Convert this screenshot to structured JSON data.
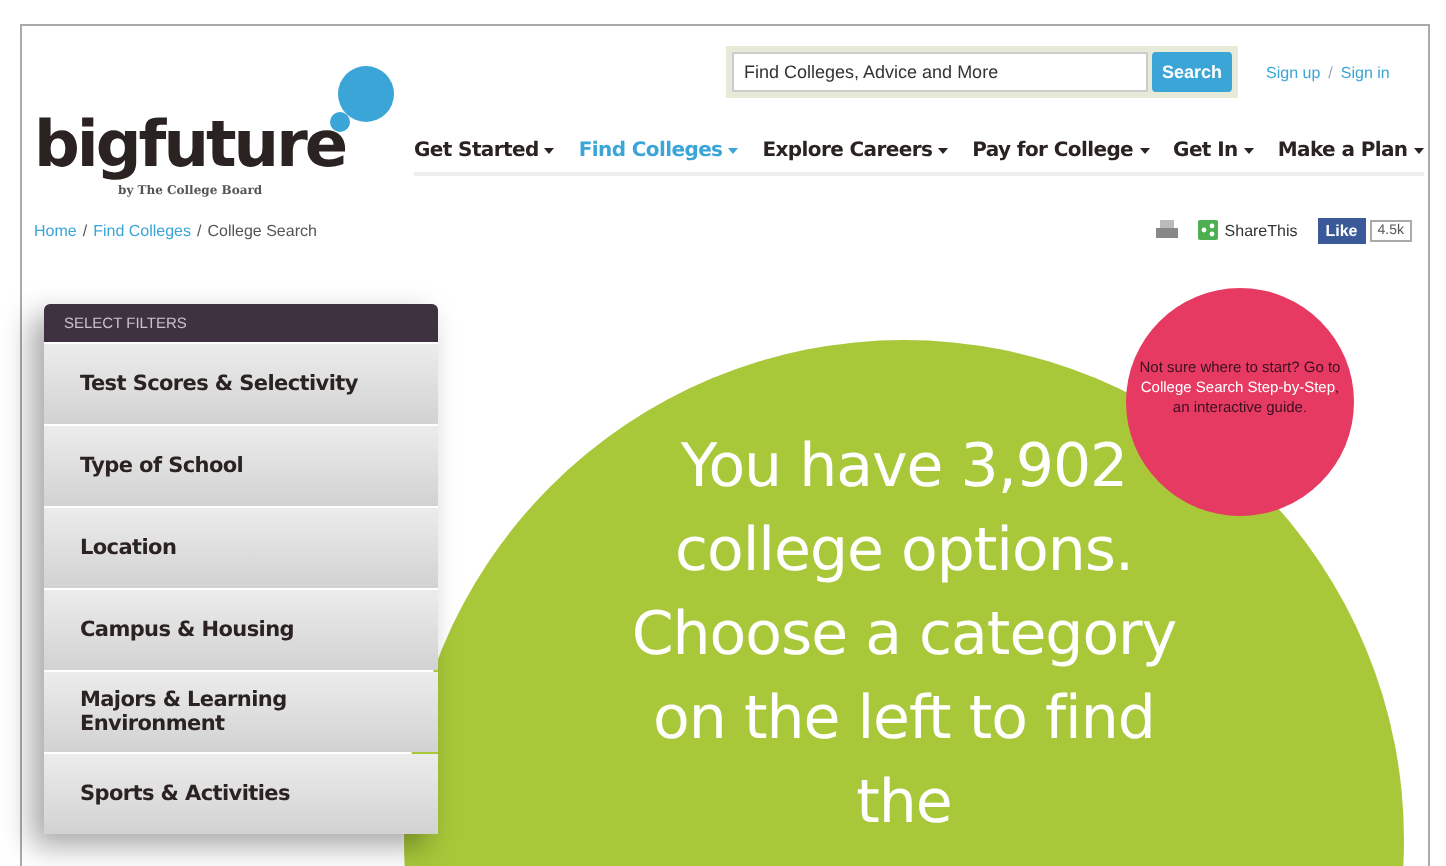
{
  "header": {
    "logo": {
      "name": "bigfuture",
      "tagline": "by The College Board"
    },
    "search": {
      "placeholder": "Find Colleges, Advice and More",
      "button": "Search"
    },
    "account_links": [
      "Sign up",
      "Sign in"
    ],
    "account_separator": "/",
    "nav": [
      {
        "label": "Get Started",
        "selected": false
      },
      {
        "label": "Find Colleges",
        "selected": true
      },
      {
        "label": "Explore Careers",
        "selected": false
      },
      {
        "label": "Pay for College",
        "selected": false
      },
      {
        "label": "Get In",
        "selected": false
      },
      {
        "label": "Make a Plan",
        "selected": false
      }
    ]
  },
  "breadcrumb": [
    {
      "label": "Home",
      "kind": "link"
    },
    {
      "label": "/",
      "kind": "separator"
    },
    {
      "label": "Find Colleges",
      "kind": "link"
    },
    {
      "label": "/",
      "kind": "separator"
    },
    {
      "label": "College Search",
      "kind": "current"
    }
  ],
  "share": {
    "share_label": "ShareThis",
    "like_label": "Like",
    "like_count": "4.5k"
  },
  "filters": {
    "title": "SELECT FILTERS",
    "items": [
      "Test Scores & Selectivity",
      "Type of School",
      "Location",
      "Campus & Housing",
      "Majors & Learning Environment",
      "Sports & Activities"
    ]
  },
  "hero": {
    "message": "You have 3,902 college options. Choose a category on the left to find the"
  },
  "guide": {
    "before": "Not sure where to start? Go to",
    "link": "College Search Step-by-Step",
    "after": ", an interactive guide."
  }
}
